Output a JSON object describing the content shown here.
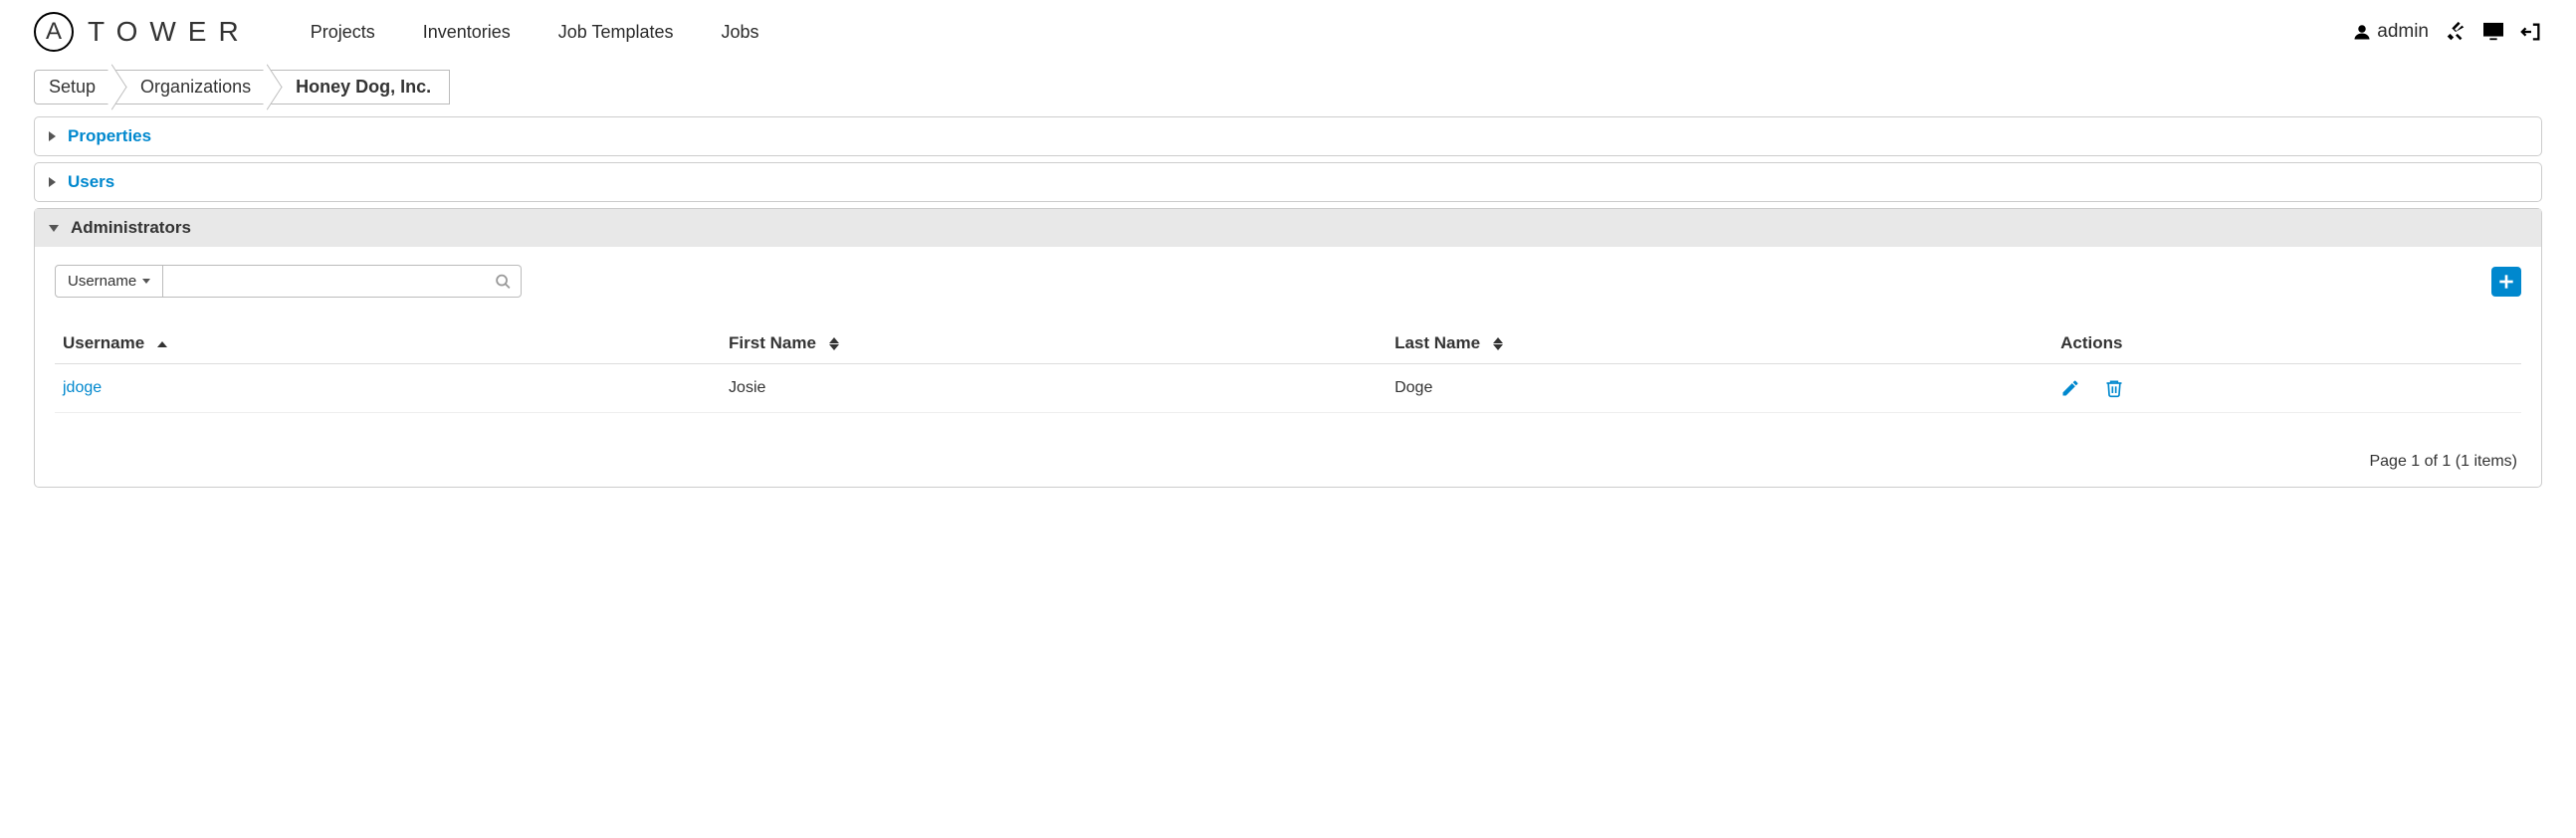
{
  "brand": {
    "letter": "A",
    "name": "TOWER"
  },
  "nav": {
    "projects": "Projects",
    "inventories": "Inventories",
    "job_templates": "Job Templates",
    "jobs": "Jobs"
  },
  "user": {
    "name": "admin"
  },
  "breadcrumb": {
    "setup": "Setup",
    "organizations": "Organizations",
    "current": "Honey Dog, Inc."
  },
  "panels": {
    "properties": "Properties",
    "users": "Users",
    "administrators": "Administrators"
  },
  "filter": {
    "selected": "Username"
  },
  "table": {
    "headers": {
      "username": "Username",
      "first_name": "First Name",
      "last_name": "Last Name",
      "actions": "Actions"
    },
    "rows": [
      {
        "username": "jdoge",
        "first_name": "Josie",
        "last_name": "Doge"
      }
    ]
  },
  "pagination": "Page 1 of 1 (1 items)"
}
